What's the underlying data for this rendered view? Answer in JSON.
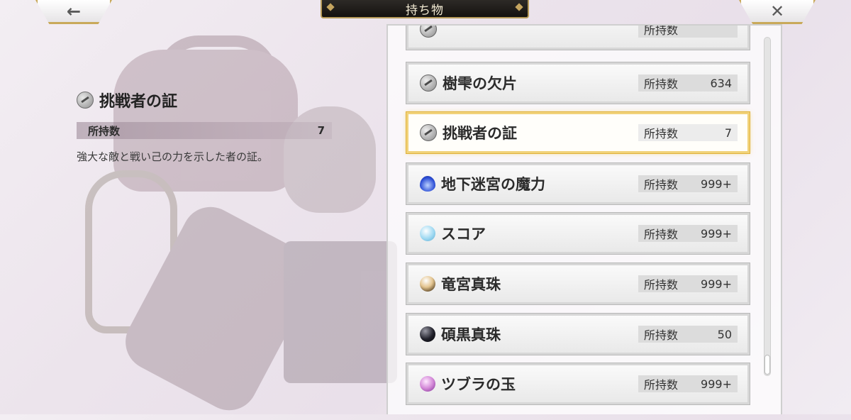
{
  "header": {
    "title": "持ち物",
    "back_glyph": "←",
    "close_glyph": "✕"
  },
  "detail": {
    "name": "挑戦者の証",
    "icon": "key-icon",
    "count_label": "所持数",
    "count_value": "7",
    "description": "強大な敵と戦い己の力を示した者の証。"
  },
  "list": {
    "items": [
      {
        "name": "",
        "icon": "key-icon",
        "count_label": "所持数",
        "count_value": ""
      },
      {
        "name": "樹雫の欠片",
        "icon": "key-icon",
        "count_label": "所持数",
        "count_value": "634"
      },
      {
        "name": "挑戦者の証",
        "icon": "key-icon",
        "count_label": "所持数",
        "count_value": "7",
        "selected": true
      },
      {
        "name": "地下迷宮の魔力",
        "icon": "blue-flame-icon",
        "count_label": "所持数",
        "count_value": "999+"
      },
      {
        "name": "スコア",
        "icon": "light-blue-orb-icon",
        "count_label": "所持数",
        "count_value": "999+"
      },
      {
        "name": "竜宮真珠",
        "icon": "gold-pearl-icon",
        "count_label": "所持数",
        "count_value": "999+"
      },
      {
        "name": "碩黒真珠",
        "icon": "black-pearl-icon",
        "count_label": "所持数",
        "count_value": "50"
      },
      {
        "name": "ツブラの玉",
        "icon": "purple-orb-icon",
        "count_label": "所持数",
        "count_value": "999+"
      }
    ]
  },
  "colors": {
    "accent_gold": "#c9a95a",
    "selected_border": "#f1d27a",
    "title_bg": "#141210"
  }
}
